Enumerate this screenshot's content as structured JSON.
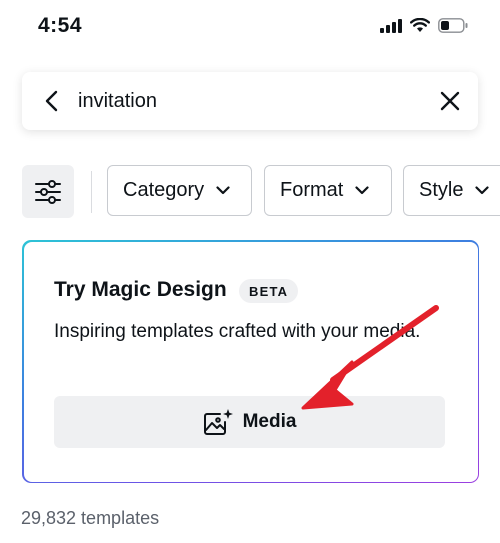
{
  "status_bar": {
    "time": "4:54",
    "icons": [
      "signal-icon",
      "wifi-icon",
      "battery-icon"
    ]
  },
  "search": {
    "query": "invitation",
    "icons": [
      "back-arrow-icon",
      "clear-x-icon"
    ]
  },
  "filters": {
    "filter_icon": "sliders-icon",
    "chips": [
      {
        "label": "Category",
        "icon": "chevron-down-icon"
      },
      {
        "label": "Format",
        "icon": "chevron-down-icon"
      },
      {
        "label": "Style",
        "icon": "chevron-down-icon"
      }
    ]
  },
  "magic_card": {
    "title": "Try Magic Design",
    "badge": "BETA",
    "description": "Inspiring templates crafted with your media.",
    "button_label": "Media",
    "button_icon": "image-sparkle-icon"
  },
  "results": {
    "count_text": "29,832 templates"
  },
  "colors": {
    "annotation_arrow": "#e3212b",
    "chip_border": "#c8cbd0",
    "button_bg": "#eff0f2",
    "gradient": [
      "#2dc3d6",
      "#3d7fe0",
      "#6a55e6",
      "#9c3fe0"
    ]
  }
}
